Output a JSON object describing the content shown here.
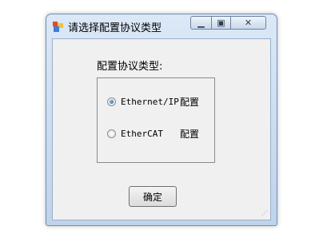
{
  "window": {
    "title": "请选择配置协议类型"
  },
  "form": {
    "label": "配置协议类型:",
    "options": [
      {
        "label": "Ethernet/IP",
        "config": "配置",
        "checked": true
      },
      {
        "label": "EtherCAT",
        "config": "配置",
        "checked": false
      }
    ],
    "ok_label": "确定"
  }
}
